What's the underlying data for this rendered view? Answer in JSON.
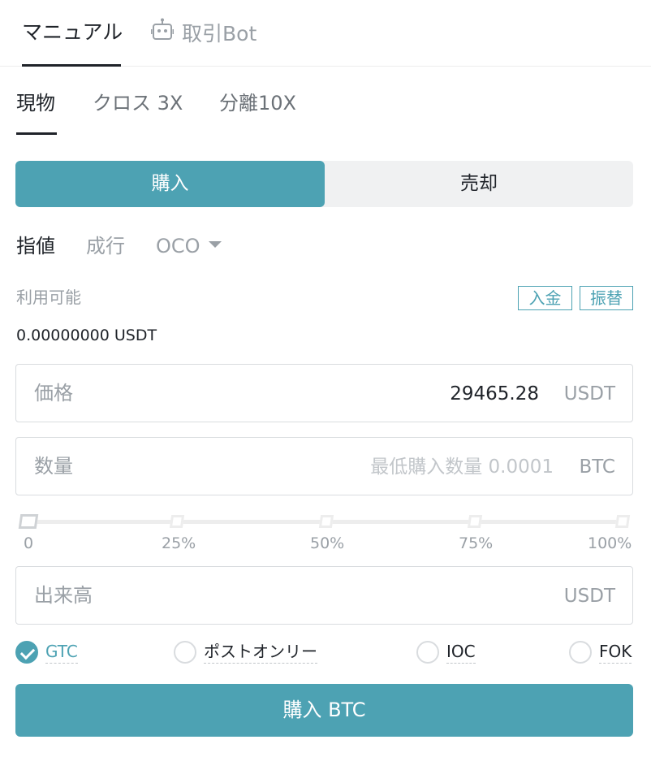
{
  "top_tabs": {
    "manual": "マニュアル",
    "bot": "取引Bot",
    "bot_icon": "robot-icon"
  },
  "mode_tabs": {
    "spot": "現物",
    "cross": "クロス 3X",
    "isolated": "分離10X"
  },
  "side": {
    "buy": "購入",
    "sell": "売却"
  },
  "order_types": {
    "limit": "指値",
    "market": "成行",
    "oco": "OCO"
  },
  "available": {
    "label": "利用可能",
    "value": "0.00000000 USDT",
    "deposit": "入金",
    "transfer": "振替"
  },
  "price_field": {
    "label": "価格",
    "value": "29465.28",
    "unit": "USDT"
  },
  "amount_field": {
    "label": "数量",
    "hint": "最低購入数量 0.0001",
    "unit": "BTC"
  },
  "slider": {
    "labels": [
      "0",
      "25%",
      "50%",
      "75%",
      "100%"
    ],
    "value_percent": 0
  },
  "total_field": {
    "label": "出来高",
    "unit": "USDT"
  },
  "time_in_force": {
    "gtc": "GTC",
    "post_only": "ポストオンリー",
    "ioc": "IOC",
    "fok": "FOK",
    "selected": "GTC"
  },
  "submit_label": "購入 BTC",
  "colors": {
    "accent": "#4da2b3",
    "text": "#1f2329",
    "muted": "#9aa0a6"
  }
}
